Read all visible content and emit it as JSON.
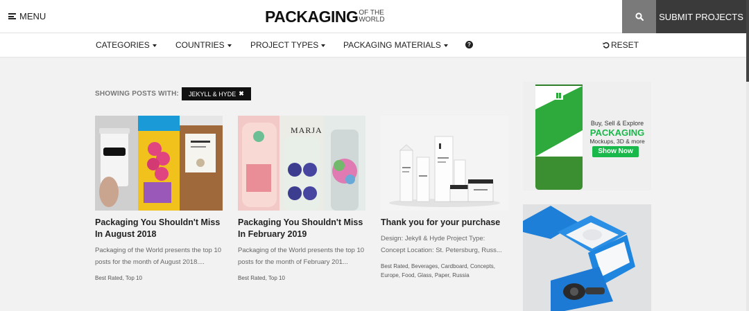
{
  "header": {
    "menu_label": "MENU",
    "logo_main": "PACKAGING",
    "logo_sub_line1": "OF THE",
    "logo_sub_line2": "WORLD",
    "submit_label": "SUBMIT PROJECTS"
  },
  "filters": {
    "items": [
      "CATEGORIES",
      "COUNTRIES",
      "PROJECT TYPES",
      "PACKAGING MATERIALS"
    ],
    "reset_label": "RESET"
  },
  "showing": {
    "label": "SHOWING POSTS WITH:",
    "tag": "JEKYLL & HYDE"
  },
  "posts": [
    {
      "title": "Packaging You Shouldn't Miss In August 2018",
      "excerpt": "Packaging of the World presents the top 10 posts for the month of August 2018....",
      "tags": [
        "Best Rated",
        "Top 10"
      ]
    },
    {
      "title": "Packaging You Shouldn't Miss In February 2019",
      "excerpt": "Packaging of the World presents the top 10 posts for the month of February 201...",
      "tags": [
        "Best Rated",
        "Top 10"
      ],
      "image_text": "MARJA"
    },
    {
      "title": "Thank you for your purchase",
      "excerpt": "Design: Jekyll & Hyde Project Type: Concept Location: St. Petersburg, Russ...",
      "tags": [
        "Best Rated",
        "Beverages",
        "Cardboard",
        "Concepts",
        "Europe",
        "Food",
        "Glass",
        "Paper",
        "Russia"
      ]
    }
  ],
  "ads": {
    "ad1": {
      "line1": "Buy, Sell & Explore",
      "headline": "PACKAGING",
      "line2": "Mockups, 3D & more",
      "cta": "Show Now"
    }
  },
  "colors": {
    "accent_green": "#19b84a",
    "submit_bg": "#3a3a3a",
    "search_bg": "#7a7a7a"
  }
}
